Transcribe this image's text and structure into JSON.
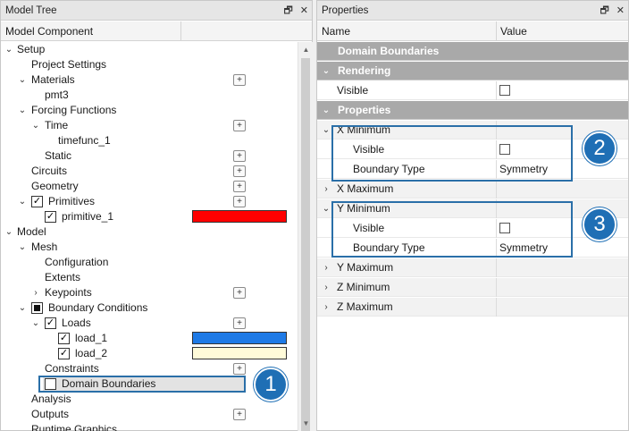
{
  "model_tree": {
    "title": "Model Tree",
    "column_header": "Model Component",
    "pin_icon": "pin-icon",
    "close_icon": "close-icon",
    "rows": [
      {
        "label": "Setup"
      },
      {
        "label": "Project Settings"
      },
      {
        "label": "Materials"
      },
      {
        "label": "pmt3"
      },
      {
        "label": "Forcing Functions"
      },
      {
        "label": "Time"
      },
      {
        "label": "timefunc_1"
      },
      {
        "label": "Static"
      },
      {
        "label": "Circuits"
      },
      {
        "label": "Geometry"
      },
      {
        "label": "Primitives"
      },
      {
        "label": "primitive_1"
      },
      {
        "label": "Model"
      },
      {
        "label": "Mesh"
      },
      {
        "label": "Configuration"
      },
      {
        "label": "Extents"
      },
      {
        "label": "Keypoints"
      },
      {
        "label": "Boundary Conditions"
      },
      {
        "label": "Loads"
      },
      {
        "label": "load_1"
      },
      {
        "label": "load_2"
      },
      {
        "label": "Constraints"
      },
      {
        "label": "Domain Boundaries"
      },
      {
        "label": "Analysis"
      },
      {
        "label": "Outputs"
      },
      {
        "label": "Runtime Graphics"
      }
    ],
    "colors": {
      "primitive_1": "#ff0000",
      "load_1": "#1e7ae6",
      "load_2": "#fffbd9"
    },
    "plus_label": "+"
  },
  "properties": {
    "title": "Properties",
    "header_name": "Name",
    "header_value": "Value",
    "rows": [
      {
        "name": "Domain Boundaries",
        "value": ""
      },
      {
        "name": "Rendering",
        "value": ""
      },
      {
        "name": "Visible",
        "value": ""
      },
      {
        "name": "Properties",
        "value": ""
      },
      {
        "name": "X Minimum",
        "value": ""
      },
      {
        "name": "Visible",
        "value": ""
      },
      {
        "name": "Boundary Type",
        "value": "Symmetry"
      },
      {
        "name": "X Maximum",
        "value": ""
      },
      {
        "name": "Y Minimum",
        "value": ""
      },
      {
        "name": "Visible",
        "value": ""
      },
      {
        "name": "Boundary Type",
        "value": "Symmetry"
      },
      {
        "name": "Y Maximum",
        "value": ""
      },
      {
        "name": "Z Minimum",
        "value": ""
      },
      {
        "name": "Z Maximum",
        "value": ""
      }
    ]
  },
  "callouts": {
    "one": "1",
    "two": "2",
    "three": "3"
  },
  "accent_color": "#1f6fb5"
}
